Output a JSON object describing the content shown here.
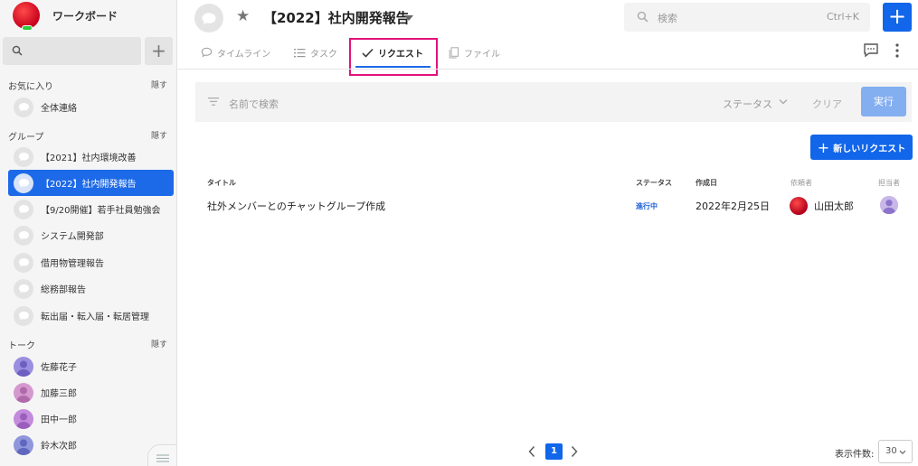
{
  "workspace": {
    "title": "ワークボード"
  },
  "sidebar": {
    "favorites": {
      "label": "お気に入り",
      "hide": "隠す",
      "items": [
        {
          "label": "全体連絡"
        }
      ]
    },
    "groups": {
      "label": "グループ",
      "hide": "隠す",
      "items": [
        {
          "label": "【2021】社内環境改善"
        },
        {
          "label": "【2022】社内開発報告",
          "active": true
        },
        {
          "label": "【9/20開催】若手社員勉強会"
        },
        {
          "label": "システム開発部"
        },
        {
          "label": "借用物管理報告"
        },
        {
          "label": "総務部報告"
        },
        {
          "label": "転出届・転入届・転居管理"
        }
      ]
    },
    "talks": {
      "label": "トーク",
      "hide": "隠す",
      "items": [
        {
          "label": "佐藤花子",
          "color": "#9a8ee0"
        },
        {
          "label": "加藤三郎",
          "color": "#d49ad0"
        },
        {
          "label": "田中一郎",
          "color": "#c38bdc"
        },
        {
          "label": "鈴木次郎",
          "color": "#8f96dc"
        }
      ]
    }
  },
  "header": {
    "title": "【2022】社内開発報告",
    "search_placeholder": "検索",
    "search_shortcut": "Ctrl+K"
  },
  "tabs": [
    {
      "label": "タイムライン",
      "icon": "speech-bubble-icon"
    },
    {
      "label": "タスク",
      "icon": "list-icon"
    },
    {
      "label": "リクエスト",
      "icon": "check-icon",
      "active": true
    },
    {
      "label": "ファイル",
      "icon": "file-icon"
    }
  ],
  "filter": {
    "name_placeholder": "名前で検索",
    "status_label": "ステータス",
    "clear_label": "クリア",
    "run_label": "実行"
  },
  "new_request_label": "新しいリクエスト",
  "table": {
    "headers": {
      "title": "タイトル",
      "status": "ステータス",
      "created": "作成日",
      "requester": "依頼者",
      "assignee": "担当者"
    },
    "rows": [
      {
        "title": "社外メンバーとのチャットグループ作成",
        "status": "進行中",
        "created": "2022年2月25日",
        "requester": "山田太郎"
      }
    ]
  },
  "pagination": {
    "current_page": "1",
    "per_page_label": "表示件数:",
    "per_page": "30"
  },
  "colors": {
    "accent": "#1166ea",
    "active_sidebar": "#1d6ae8",
    "highlight": "#e2127a",
    "status_text": "#1d5fd6"
  }
}
